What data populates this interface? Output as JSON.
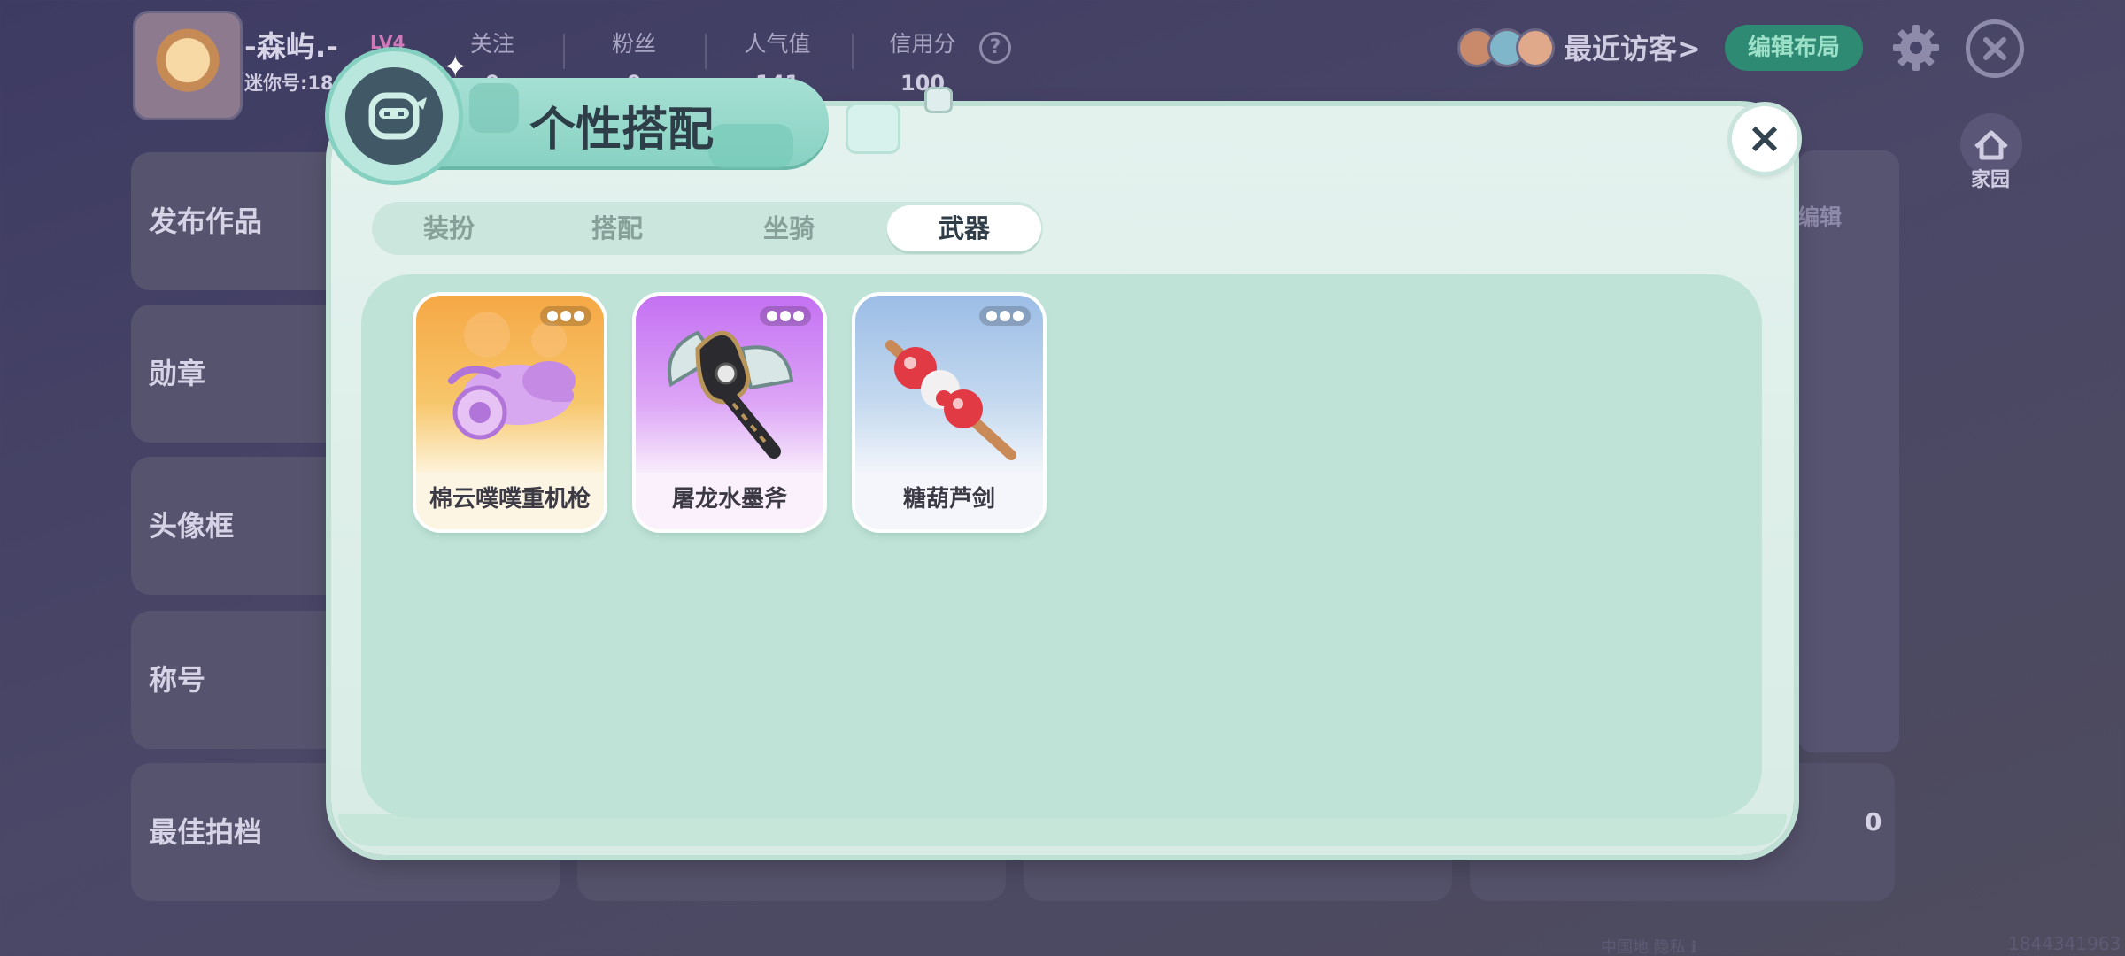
{
  "profile": {
    "name": "-森屿.-",
    "level": "LV4",
    "mini_id": "迷你号:18",
    "stats": [
      {
        "label": "关注",
        "value": "0"
      },
      {
        "label": "粉丝",
        "value": "0"
      },
      {
        "label": "人气值",
        "value": "141"
      },
      {
        "label": "信用分",
        "value": "100"
      }
    ],
    "help": "?",
    "recent_visitors": "最近访客>",
    "edit_layout": "编辑布局",
    "home": "家园",
    "edit": "编辑",
    "sections": [
      "发布作品",
      "勋章",
      "头像框",
      "称号",
      "最佳拍档"
    ],
    "best_partner_count": "0",
    "uid_footer": "1844341963",
    "footer_left": "中国地 隐私 ℹ"
  },
  "modal": {
    "title": "个性搭配",
    "close": "×",
    "tabs": [
      {
        "label": "装扮",
        "active": false
      },
      {
        "label": "搭配",
        "active": false
      },
      {
        "label": "坐骑",
        "active": false
      },
      {
        "label": "武器",
        "active": true
      }
    ],
    "items": [
      {
        "name": "棉云噗噗重机枪",
        "theme": "orange",
        "icon": "cloud-cannon-icon"
      },
      {
        "name": "屠龙水墨斧",
        "theme": "purple",
        "icon": "dragon-axe-icon"
      },
      {
        "name": "糖葫芦剑",
        "theme": "blue",
        "icon": "candied-haws-sword-icon"
      }
    ]
  },
  "colors": {
    "accent": "#2f8a73",
    "modal_bg": "#e4f2ee",
    "content_bg": "#c0e3d8",
    "active_tab": "#ffffff"
  }
}
